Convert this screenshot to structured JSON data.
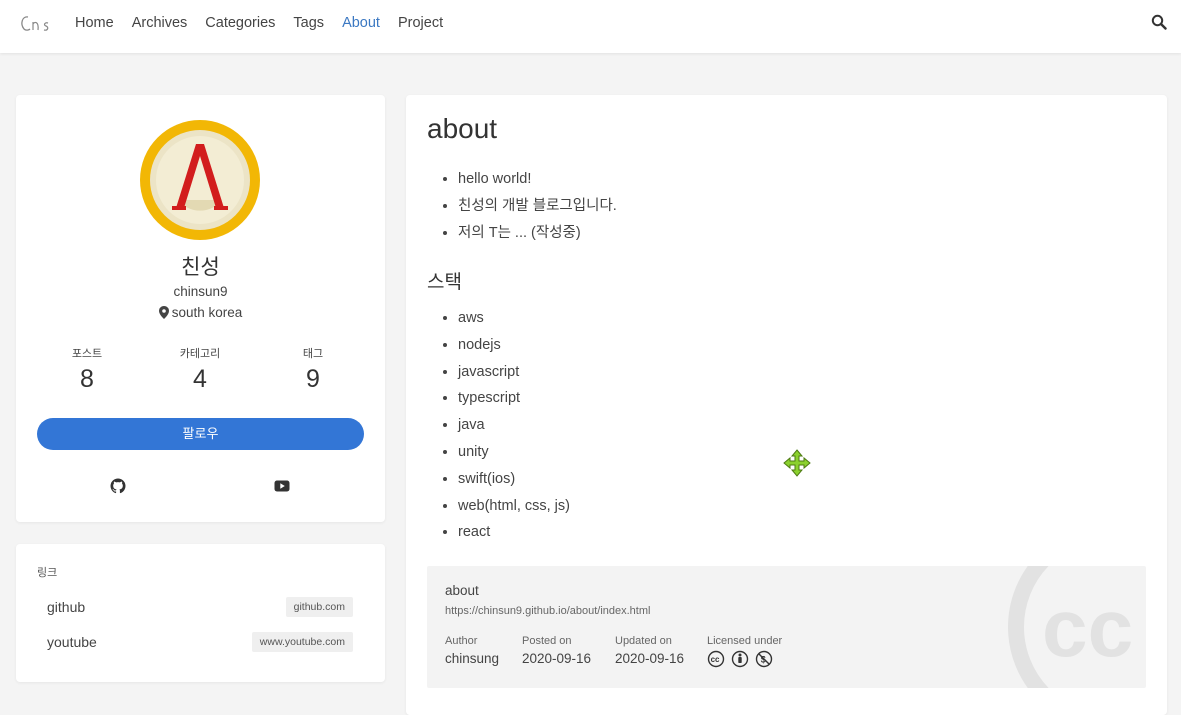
{
  "logo": {
    "alt": "logo"
  },
  "nav": {
    "items": [
      "Home",
      "Archives",
      "Categories",
      "Tags",
      "About",
      "Project"
    ],
    "active": "About"
  },
  "profile": {
    "name": "친성",
    "username": "chinsun9",
    "location": "south korea",
    "stats": [
      {
        "label": "포스트",
        "value": "8"
      },
      {
        "label": "카테고리",
        "value": "4"
      },
      {
        "label": "태그",
        "value": "9"
      }
    ],
    "follow_label": "팔로우",
    "social": [
      "github-icon",
      "youtube-icon"
    ]
  },
  "links": {
    "title": "링크",
    "items": [
      {
        "name": "github",
        "domain": "github.com"
      },
      {
        "name": "youtube",
        "domain": "www.youtube.com"
      }
    ]
  },
  "article": {
    "title": "about",
    "intro": [
      "hello world!",
      "친성의 개발 블로그입니다.",
      "저의 T는 ... (작성중)"
    ],
    "stack_heading": "스택",
    "stack": [
      "aws",
      "nodejs",
      "javascript",
      "typescript",
      "java",
      "unity",
      "swift(ios)",
      "web(html, css, js)",
      "react"
    ]
  },
  "meta": {
    "title": "about",
    "url": "https://chinsun9.github.io/about/index.html",
    "author_label": "Author",
    "author": "chinsung",
    "posted_label": "Posted on",
    "posted": "2020-09-16",
    "updated_label": "Updated on",
    "updated": "2020-09-16",
    "license_label": "Licensed under"
  },
  "colors": {
    "accent": "#3b78c2",
    "button": "#3376d6",
    "avatar_ring": "#f2b705",
    "avatar_symbol": "#d21d1d"
  }
}
